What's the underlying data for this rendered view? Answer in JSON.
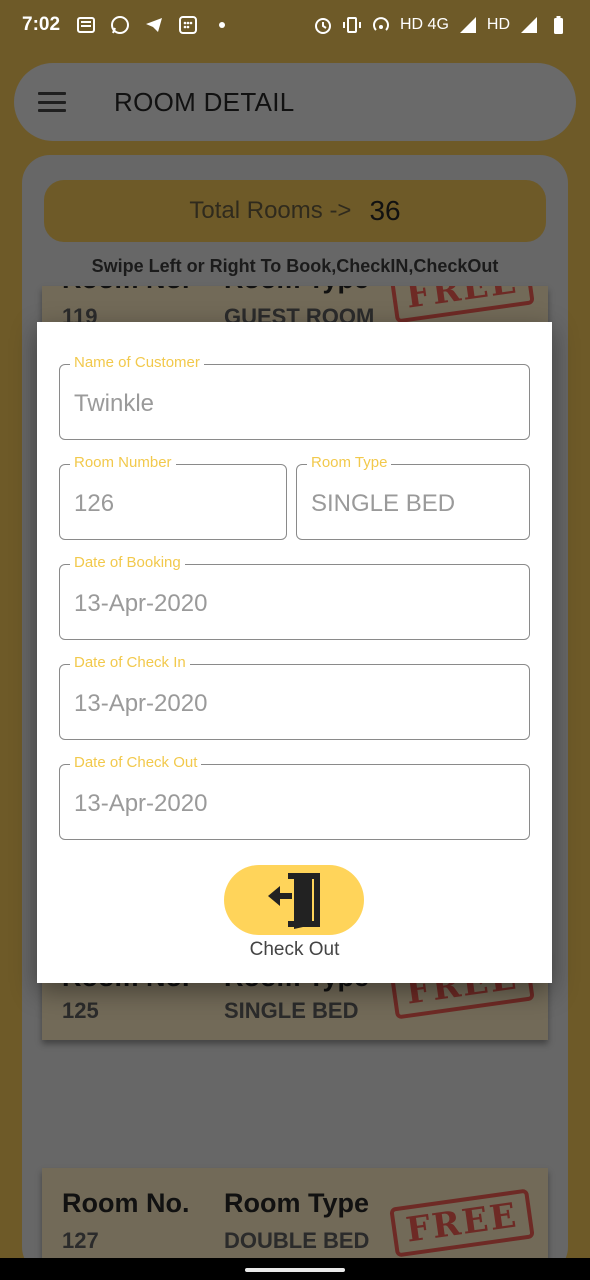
{
  "status_bar": {
    "time": "7:02",
    "network_text": "HD 4G",
    "network_text2": "HD"
  },
  "app_bar": {
    "title": "ROOM DETAIL"
  },
  "summary": {
    "total_label": "Total Rooms ->",
    "total_value": "36",
    "swipe_hint": "Swipe Left or Right To Book,CheckIN,CheckOut"
  },
  "rooms": [
    {
      "no_label": "Room No.",
      "type_label": "Room Type",
      "number": "119",
      "type": "GUEST ROOM",
      "status": "FREE"
    },
    {
      "no_label": "Room No.",
      "type_label": "Room Type",
      "number": "125",
      "type": "SINGLE BED",
      "status": "FREE"
    },
    {
      "no_label": "Room No.",
      "type_label": "Room Type",
      "number": "127",
      "type": "DOUBLE BED",
      "status": "FREE"
    }
  ],
  "dialog": {
    "customer": {
      "label": "Name of Customer",
      "value": "Twinkle"
    },
    "room_number": {
      "label": "Room Number",
      "value": "126"
    },
    "room_type": {
      "label": "Room Type",
      "value": "SINGLE BED"
    },
    "booking_date": {
      "label": "Date of Booking",
      "value": "13-Apr-2020"
    },
    "checkin_date": {
      "label": "Date of Check In",
      "value": "13-Apr-2020"
    },
    "checkout_date": {
      "label": "Date of Check Out",
      "value": "13-Apr-2020"
    },
    "checkout_button_label": "Check Out",
    "checkout_icon": "exit-door-icon"
  },
  "colors": {
    "accent": "#ffd45a",
    "label": "#f2c94c",
    "stamp": "#b3312a"
  }
}
